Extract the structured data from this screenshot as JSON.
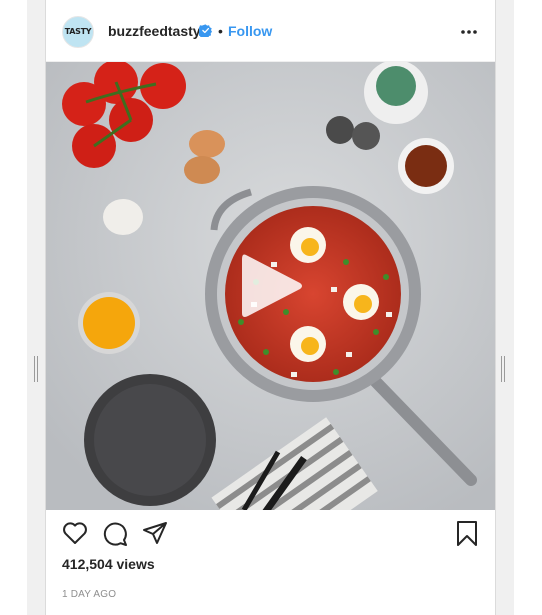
{
  "post": {
    "username": "buzzfeedtasty",
    "separator": "•",
    "follow_label": "Follow",
    "avatar_text": "TASTY",
    "views": "412,504 views",
    "time_ago": "1 DAY AGO"
  },
  "icons": {
    "verified": "verified-badge-icon",
    "more": "more-options-icon",
    "play": "play-icon",
    "like": "heart-icon",
    "comment": "comment-icon",
    "share": "share-icon",
    "save": "bookmark-icon"
  },
  "colors": {
    "link": "#3897f0",
    "text": "#262626",
    "muted": "#8e8e8e"
  }
}
